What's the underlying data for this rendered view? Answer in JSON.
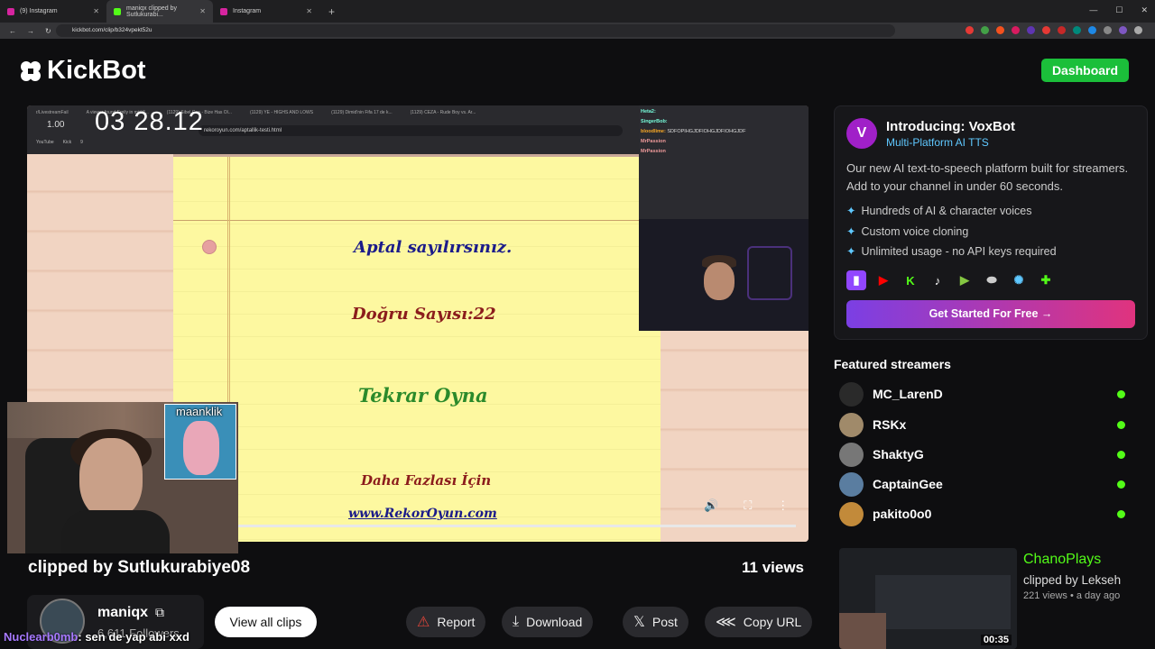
{
  "browser": {
    "tabs": [
      {
        "title": "(9) Instagram"
      },
      {
        "title": "maniqx clipped by Sutlukurabi..."
      },
      {
        "title": "Instagram"
      }
    ],
    "url": "kickbot.com/clip/b324vpekt52u"
  },
  "header": {
    "brand": "KickBot",
    "dashboard_label": "Dashboard"
  },
  "video": {
    "speed": "1.00",
    "timer": "03 28.12",
    "inner_url": "rekoroyun.com/aptallik-testi.html",
    "inner_tabs": [
      "r/LivestreamFail",
      "A viewer found Emily in middl...",
      "(1129) Sibel Can - Bize Has Ol...",
      "(1129) YE - HIGHS AND LOWS",
      "(1129) Dimid'nin Fifa 17 de k...",
      "(1129) CEZA - Rude Boy vs. Ar..."
    ],
    "bookmarks": [
      "YouTube",
      "Kick",
      "9"
    ],
    "game": {
      "result": "Aptal sayılırsınız.",
      "score": "Doğru Sayısı:22",
      "replay": "Tekrar Oyna",
      "more": "Daha Fazlası İçin",
      "site": "www.RekorOyun.com"
    },
    "chat": [
      {
        "user": "Heta2:",
        "text": ""
      },
      {
        "user": "SingerBob:",
        "text": ""
      },
      {
        "user": "bloodlime:",
        "text": "SDFOPIHGJDFIOHGJDFIOHGJDF"
      },
      {
        "user": "MrPassion",
        "text": ""
      },
      {
        "user": "MrPassion",
        "text": ""
      }
    ],
    "insert_name": "maanklik"
  },
  "clip": {
    "streamer": "maniqx",
    "clipped_by": "clipped by Sutlukurabiye08",
    "views": "11 views"
  },
  "channel": {
    "name": "maniqx",
    "followers": "6,611 Followers",
    "view_all_label": "View all clips"
  },
  "actions": {
    "report": "Report",
    "download": "Download",
    "post": "Post",
    "copy_url": "Copy URL"
  },
  "overlay_chat": {
    "user": "Nuclearb0mb",
    "text": ": sen de yap abi xxd"
  },
  "promo": {
    "logo": "V",
    "title": "Introducing: VoxBot",
    "subtitle": "Multi-Platform AI TTS",
    "description": "Our new AI text-to-speech platform built for streamers. Add to your channel in under 60 seconds.",
    "features": [
      "Hundreds of AI & character voices",
      "Custom voice cloning",
      "Unlimited usage - no API keys required"
    ],
    "cta": "Get Started For Free →",
    "platform_icons": [
      "twitch-icon",
      "youtube-icon",
      "kick-icon",
      "tiktok-icon",
      "rumble-icon",
      "pill-icon",
      "party-icon",
      "puzzle-icon"
    ]
  },
  "featured": {
    "heading": "Featured streamers",
    "streamers": [
      {
        "name": "MC_LarenD"
      },
      {
        "name": "RSKx"
      },
      {
        "name": "ShaktyG"
      },
      {
        "name": "CaptainGee"
      },
      {
        "name": "pakito0o0"
      }
    ]
  },
  "related_clip": {
    "streamer": "ChanoPlays",
    "clipped_by": "clipped by Lekseh",
    "meta": "221 views • a day ago",
    "duration": "00:35"
  },
  "colors": {
    "kick_green": "#53fc18",
    "dashboard_green": "#1bbf3a",
    "accent_blue": "#5fc8ff",
    "background": "#0e0e10"
  }
}
